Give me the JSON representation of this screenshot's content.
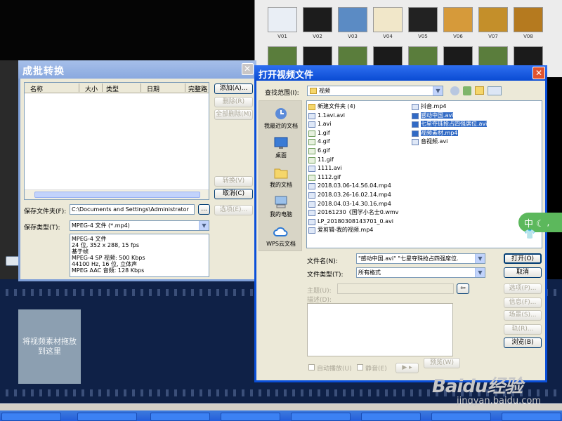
{
  "media_strip": {
    "thumbs": [
      {
        "label": "V01",
        "color": "#e9eef5"
      },
      {
        "label": "V02",
        "color": "#1c1c1c"
      },
      {
        "label": "V03",
        "color": "#5b8bc4"
      },
      {
        "label": "V04",
        "color": "#f1e7c9"
      },
      {
        "label": "V05",
        "color": "#222222"
      },
      {
        "label": "V06",
        "color": "#d69a3a"
      },
      {
        "label": "V07",
        "color": "#c48f2a"
      },
      {
        "label": "V08",
        "color": "#b57a1f"
      }
    ]
  },
  "drop_zone": {
    "text": "将视频素材拖放到这里"
  },
  "batch": {
    "title": "成批转换",
    "columns": [
      "名称",
      "大小",
      "类型",
      "日期",
      "完整路"
    ],
    "buttons": {
      "add": "添加(A)...",
      "delete": "删除(R)",
      "delete_all": "全部删除(M)",
      "convert": "转换(V)",
      "cancel": "取消(C)",
      "options": "选项(E)..."
    },
    "save_folder_label": "保存文件夹(F):",
    "save_folder_value": "C:\\Documents and Settings\\Administrator",
    "browse_btn": "...",
    "save_type_label": "保存类型(T):",
    "save_type_value": "MPEG-4 文件 (*.mp4)",
    "info_lines": [
      "MPEG-4 文件",
      "24 位, 352 x 288, 15 fps",
      "基于帧",
      "MPEG-4 SP 视频: 500 Kbps",
      "44100 Hz, 16 位, 立体声",
      "MPEG AAC 音频: 128 Kbps"
    ]
  },
  "open_dialog": {
    "title": "打开视频文件",
    "look_in_label": "查找范围(I):",
    "look_in_value": "视频",
    "places": [
      "我最近的文档",
      "桌面",
      "我的文档",
      "我的电脑",
      "WPS云文档"
    ],
    "files_col1": [
      {
        "name": "新建文件夹 (4)",
        "kind": "folder"
      },
      {
        "name": "1.1avi.avi",
        "kind": "video"
      },
      {
        "name": "1.avi",
        "kind": "video"
      },
      {
        "name": "1.gif",
        "kind": "gif"
      },
      {
        "name": "4.gif",
        "kind": "gif"
      },
      {
        "name": "6.gif",
        "kind": "gif"
      },
      {
        "name": "11.gif",
        "kind": "gif"
      },
      {
        "name": "1111.avi",
        "kind": "video"
      },
      {
        "name": "1112.gif",
        "kind": "gif"
      },
      {
        "name": "2018.03.06-14.56.04.mp4",
        "kind": "video"
      },
      {
        "name": "2018.03.26-16.02.14.mp4",
        "kind": "video"
      },
      {
        "name": "2018.04.03-14.30.16.mp4",
        "kind": "video"
      },
      {
        "name": "20161230《国学小名士0.wmv",
        "kind": "video"
      },
      {
        "name": "LP_20180308143701_0.avi",
        "kind": "video"
      },
      {
        "name": "爱剪辑-我的视频.mp4",
        "kind": "video"
      }
    ],
    "files_col2": [
      {
        "name": "抖音.mp4",
        "kind": "video",
        "selected": false
      },
      {
        "name": "感动中国.avi",
        "kind": "video",
        "selected": true
      },
      {
        "name": "七星夺珠抢占四强席位.avi",
        "kind": "video",
        "selected": true
      },
      {
        "name": "视频素材.mp4",
        "kind": "video",
        "selected": true
      },
      {
        "name": "音视频.avi",
        "kind": "video",
        "selected": false
      }
    ],
    "filename_label": "文件名(N):",
    "filename_value": "\"感动中国.avi\" \"七星夺珠抢占四强席位.",
    "filetype_label": "文件类型(T):",
    "filetype_value": "所有格式",
    "open_btn": "打开(O)",
    "cancel_btn": "取消",
    "subject_label": "主题(U):",
    "desc_label": "描述(D):",
    "side_buttons": [
      "选项(P)...",
      "信息(F)...",
      "场景(S)...",
      "轨(R)...",
      "浏览(B)"
    ],
    "preview_btn": "预览(W)",
    "autoplay_label": "自动播放(U)",
    "mute_label": "静音(E)",
    "play_btn": "▶ ▸"
  },
  "watermark": {
    "brand": "Baidu经验",
    "url": "jingyan.baidu.com"
  },
  "ime": {
    "text": "中 ☾ ⸴ 👕"
  }
}
